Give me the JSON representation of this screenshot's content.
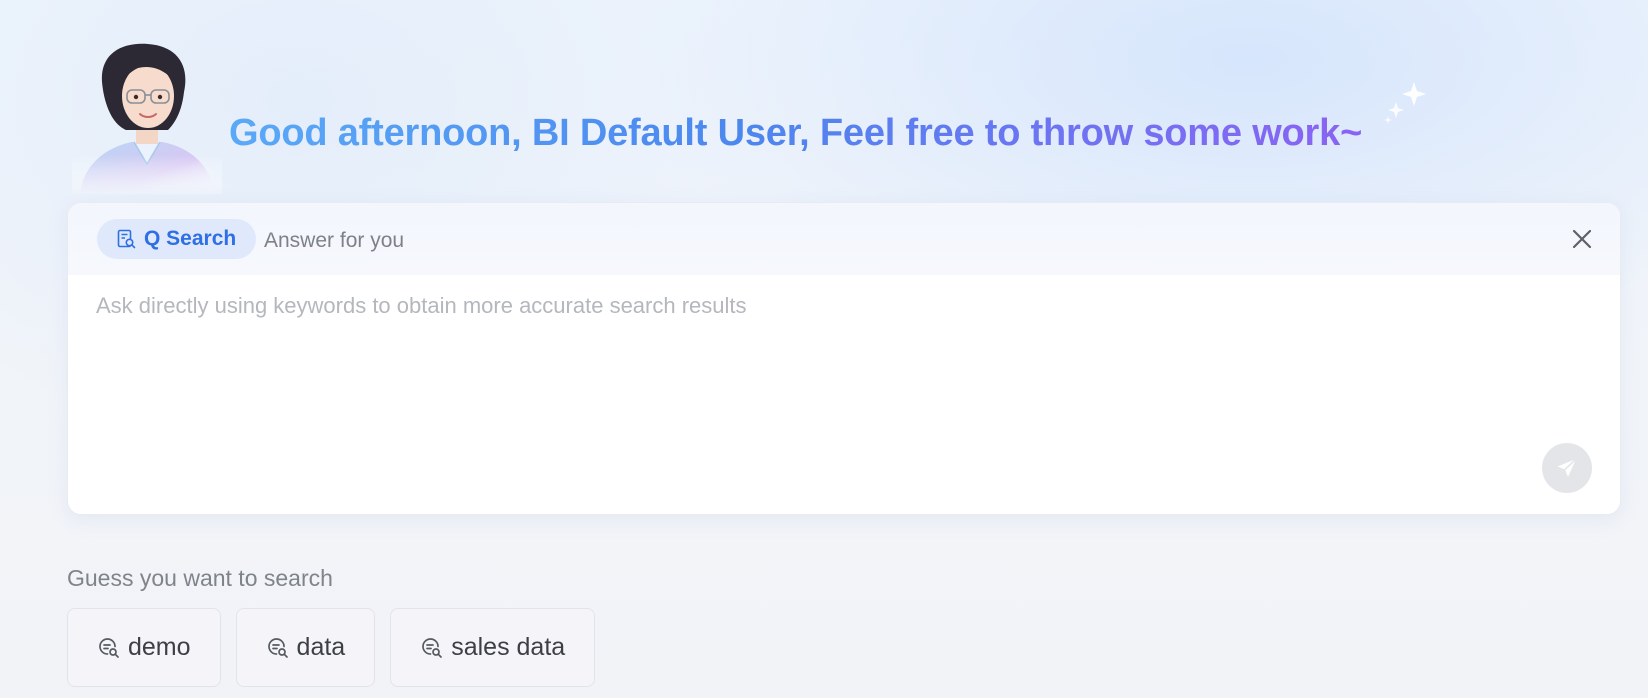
{
  "header": {
    "greeting": "Good afternoon, BI Default User, Feel free to throw some work~"
  },
  "search_card": {
    "mode_label": "Q Search",
    "mode_hint": "Answer for you",
    "input_placeholder": "Ask directly using keywords to obtain more accurate search results",
    "input_value": ""
  },
  "suggestions": {
    "title": "Guess you want to search",
    "items": [
      {
        "label": "demo"
      },
      {
        "label": "data"
      },
      {
        "label": "sales data"
      }
    ]
  },
  "colors": {
    "accent_blue": "#2e6fe6",
    "pill_bg": "#dfe9fb",
    "greeting_gradient_start": "#5aa9f7",
    "greeting_gradient_end": "#8a63f2",
    "send_button_bg": "#e4e5e8"
  },
  "icons": {
    "mode": "search-document-icon",
    "close": "close-icon",
    "send": "send-plane-icon",
    "suggestion": "chat-search-icon",
    "decoration": "sparkle-icon"
  }
}
